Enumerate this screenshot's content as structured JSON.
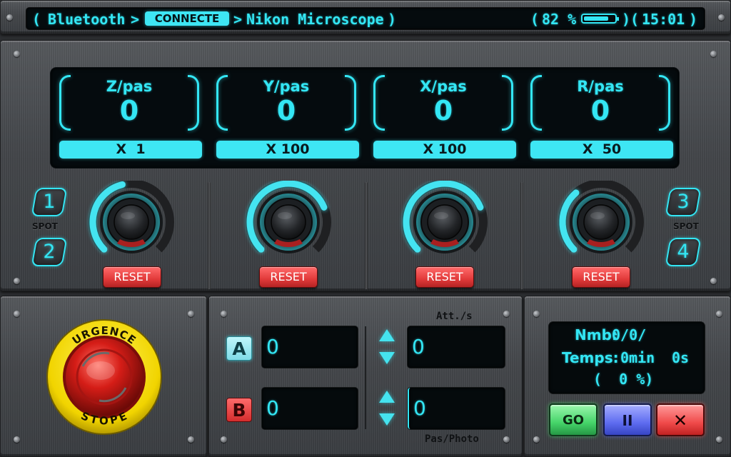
{
  "header": {
    "bluetooth_label": "Bluetooth",
    "connection_status": "CONNECTE",
    "device_name": "Nikon Microscope",
    "battery_percent": "82 %",
    "battery_level": 0.82,
    "clock": "15:01"
  },
  "axes": [
    {
      "label": "Z/pas",
      "value": "0",
      "multiplier": "X  1",
      "knob_level": 0.45
    },
    {
      "label": "Y/pas",
      "value": "0",
      "multiplier": "X 100",
      "knob_level": 0.75
    },
    {
      "label": "X/pas",
      "value": "0",
      "multiplier": "X 100",
      "knob_level": 0.75
    },
    {
      "label": "R/pas",
      "value": "0",
      "multiplier": "X  50",
      "knob_level": 0.35
    }
  ],
  "reset_label": "RESET",
  "spots": {
    "label": "SPOT",
    "buttons": [
      "1",
      "2",
      "3",
      "4"
    ]
  },
  "emergency": {
    "top_text": "URGENCE",
    "bottom_text": "STOPE"
  },
  "positions": {
    "header_label": "Att./s",
    "footer_label": "Pas/Photo",
    "a_label": "A",
    "b_label": "B",
    "a_value": "0",
    "b_value": "0",
    "att_value": "0",
    "pas_photo_value": "0"
  },
  "info": {
    "nmb_label": "Nmb:",
    "nmb_value": "0/0/",
    "temps_label": "Temps:",
    "temps_min": "0min",
    "temps_sec": "0s",
    "percent_display": "(  0 %)"
  },
  "controls": {
    "go_label": "GO",
    "pause_symbol": "II",
    "stop_symbol": "✕"
  },
  "colors": {
    "accent": "#33e6f4",
    "reset": "#e23a3a",
    "go": "#4fe07a",
    "pause": "#5e6cf0",
    "stop": "#f04a4a",
    "label_a": "#8fe9f4",
    "label_b": "#e23a3a"
  }
}
